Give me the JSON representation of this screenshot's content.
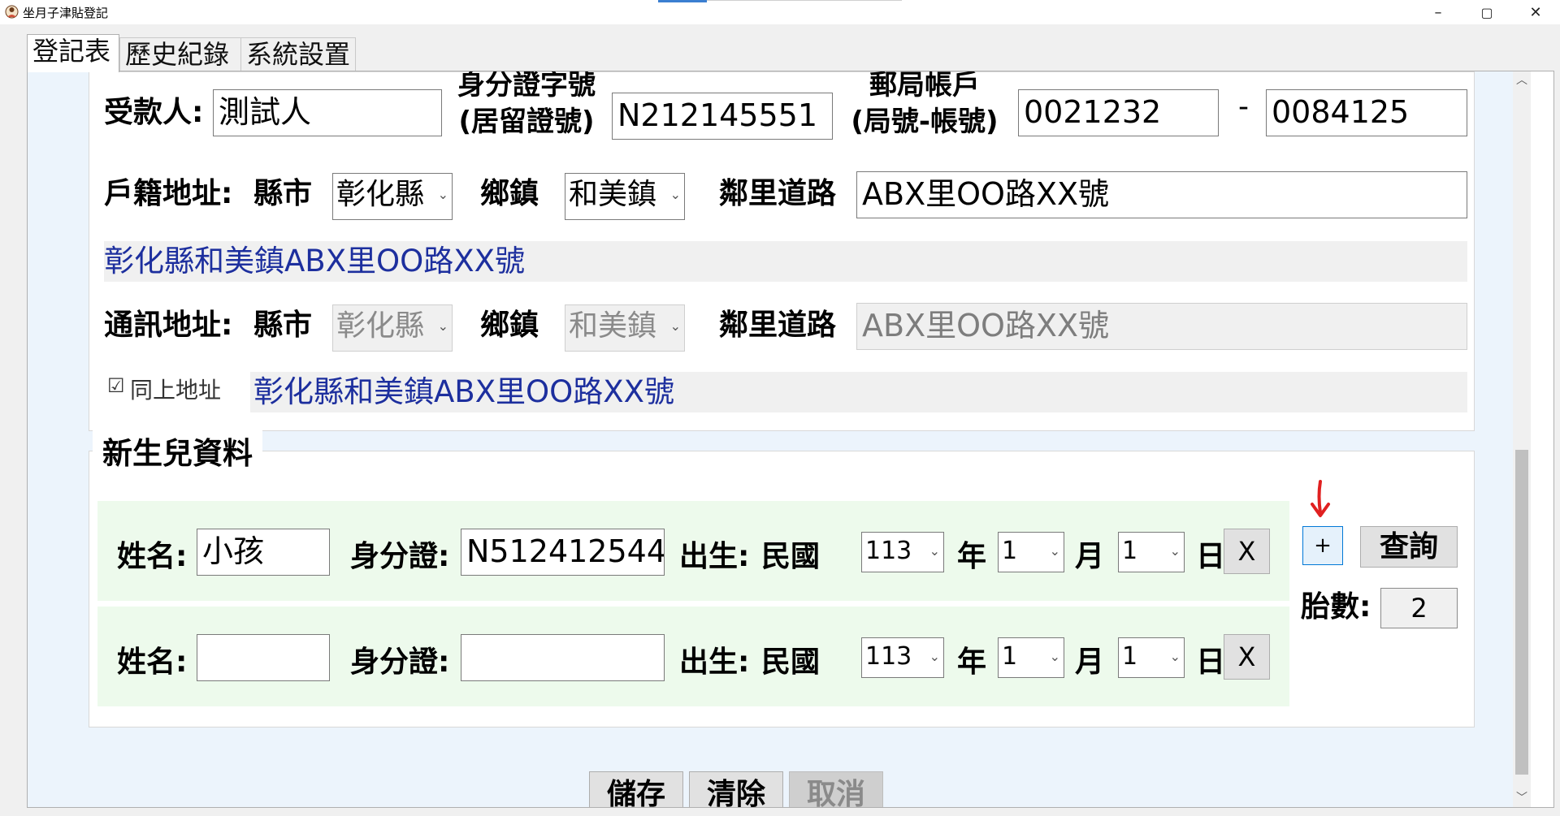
{
  "window": {
    "title": "坐月子津貼登記",
    "minimize": "–",
    "maximize": "▢",
    "close": "✕"
  },
  "tabs": [
    "登記表",
    "歷史紀錄",
    "系統設置"
  ],
  "payee": {
    "payee_label": "受款人:",
    "payee_value": "測試人",
    "id_label_line1": "身分證字號",
    "id_label_line2": "(居留證號)",
    "id_value": "N212145551",
    "post_label_line1": "郵局帳戶",
    "post_label_line2": "(局號-帳號)",
    "post_office_no": "0021232",
    "dash": "-",
    "post_account_no": "0084125"
  },
  "household_address": {
    "label": "戶籍地址:",
    "city_label": "縣市",
    "city_value": "彰化縣",
    "town_label": "鄉鎮",
    "town_value": "和美鎮",
    "road_label": "鄰里道路",
    "road_value": "ABX里OO路XX號",
    "full_preview": "彰化縣和美鎮ABX里OO路XX號"
  },
  "mailing_address": {
    "label": "通訊地址:",
    "city_label": "縣市",
    "city_value": "彰化縣",
    "town_label": "鄉鎮",
    "town_value": "和美鎮",
    "road_label": "鄰里道路",
    "road_value": "ABX里OO路XX號",
    "same_checkbox_glyph": "☑",
    "same_as_above_label": "同上地址",
    "full_preview": "彰化縣和美鎮ABX里OO路XX號"
  },
  "newborn": {
    "group_title": "新生兒資料",
    "rows": [
      {
        "name_label": "姓名:",
        "name_value": "小孩",
        "id_label": "身分證:",
        "id_value": "N512412544",
        "birth_label": "出生:",
        "era_label": "民國",
        "year_value": "113",
        "year_label": "年",
        "month_value": "1",
        "month_label": "月",
        "day_value": "1",
        "day_label": "日",
        "remove_label": "X"
      },
      {
        "name_label": "姓名:",
        "name_value": "",
        "id_label": "身分證:",
        "id_value": "",
        "birth_label": "出生:",
        "era_label": "民國",
        "year_value": "113",
        "year_label": "年",
        "month_value": "1",
        "month_label": "月",
        "day_value": "1",
        "day_label": "日",
        "remove_label": "X"
      }
    ],
    "add_label": "+",
    "query_label": "查詢",
    "births_label": "胎數:",
    "births_value": "2"
  },
  "actions": {
    "save": "儲存",
    "clear": "清除",
    "cancel": "取消"
  },
  "icons": {
    "app": "app-logo-icon",
    "chevron": "chevron-down-icon",
    "scroll_up": "scroll-up-arrow-icon",
    "scroll_down": "scroll-down-arrow-icon",
    "annotation": "red-arrow-annotation"
  },
  "colors": {
    "preview_text": "#1d2f9e",
    "content_bg": "#ecf4fc",
    "row_bg": "#edfaec",
    "annotation": "#e02020"
  }
}
